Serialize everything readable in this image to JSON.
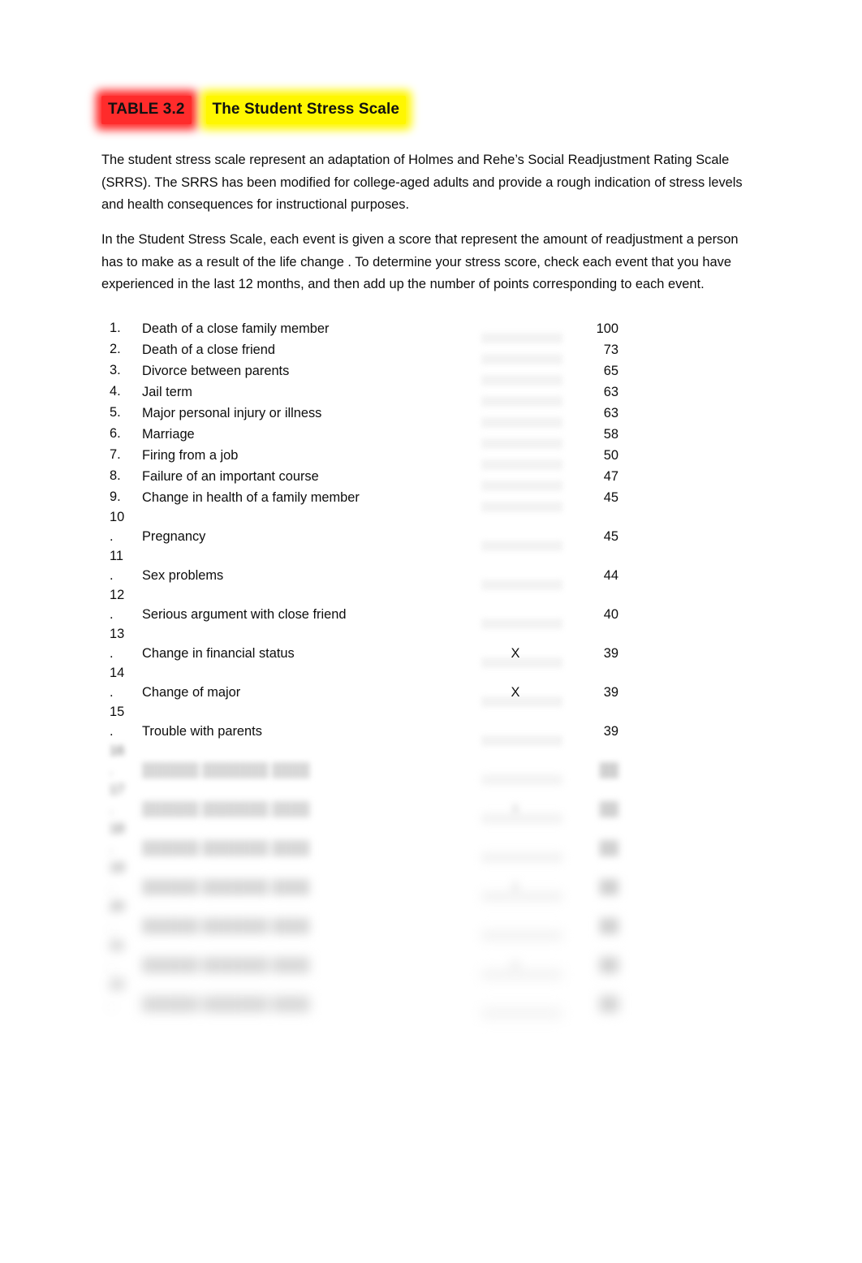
{
  "document": {
    "title_tag": "TABLE 3.2",
    "title_text": "The Student Stress Scale",
    "title_tag_highlight_color": "#ff2b2b",
    "title_text_highlight_color": "#fff700",
    "paragraphs": [
      "The student stress scale represent an adaptation of Holmes and Rehe’s Social Readjustment Rating Scale (SRRS). The SRRS has been modified for college-aged adults and provide a rough indication of stress levels and health consequences for instructional purposes.",
      "In the Student Stress Scale, each event is given a score that represent the amount of readjustment a person has to make as a result of the life change . To determine your stress score, check each event that you have experienced in the last 12 months, and then add up the number of points corresponding to each event."
    ]
  },
  "stress_scale": {
    "items": [
      {
        "number": "1.",
        "event": "Death of a close family member",
        "mark": "",
        "score": "100",
        "obscured": false
      },
      {
        "number": "2.",
        "event": "Death of a close friend",
        "mark": "",
        "score": "73",
        "obscured": false
      },
      {
        "number": "3.",
        "event": "Divorce between parents",
        "mark": "",
        "score": "65",
        "obscured": false
      },
      {
        "number": "4.",
        "event": "Jail term",
        "mark": "",
        "score": "63",
        "obscured": false
      },
      {
        "number": "5.",
        "event": "Major personal injury or illness",
        "mark": "",
        "score": "63",
        "obscured": false
      },
      {
        "number": "6.",
        "event": "Marriage",
        "mark": "",
        "score": "58",
        "obscured": false
      },
      {
        "number": "7.",
        "event": "Firing from a job",
        "mark": "",
        "score": "50",
        "obscured": false
      },
      {
        "number": "8.",
        "event": "Failure of an important course",
        "mark": "",
        "score": "47",
        "obscured": false
      },
      {
        "number": "9.",
        "event": "Change in health of a family member",
        "mark": "",
        "score": "45",
        "obscured": false
      },
      {
        "number": "10\n.",
        "event": "Pregnancy",
        "mark": "",
        "score": "45",
        "obscured": false
      },
      {
        "number": "11\n.",
        "event": "Sex problems",
        "mark": "",
        "score": "44",
        "obscured": false
      },
      {
        "number": "12\n.",
        "event": "Serious argument with close friend",
        "mark": "",
        "score": "40",
        "obscured": false
      },
      {
        "number": "13\n.",
        "event": "Change in financial status",
        "mark": "X",
        "score": "39",
        "obscured": false
      },
      {
        "number": "14\n.",
        "event": "Change of major",
        "mark": "X",
        "score": "39",
        "obscured": false
      },
      {
        "number": "15\n.",
        "event": "Trouble with parents",
        "mark": "",
        "score": "39",
        "obscured": false
      },
      {
        "number": "16\n.",
        "event": "",
        "mark": "",
        "score": "",
        "obscured": true
      },
      {
        "number": "",
        "event": "",
        "mark": "",
        "score": "",
        "obscured": true
      },
      {
        "number": "",
        "event": "",
        "mark": "",
        "score": "",
        "obscured": true
      },
      {
        "number": "",
        "event": "",
        "mark": "",
        "score": "",
        "obscured": true
      },
      {
        "number": "",
        "event": "",
        "mark": "",
        "score": "",
        "obscured": true
      },
      {
        "number": "",
        "event": "",
        "mark": "",
        "score": "",
        "obscured": true
      },
      {
        "number": "",
        "event": "",
        "mark": "",
        "score": "",
        "obscured": true
      }
    ]
  }
}
